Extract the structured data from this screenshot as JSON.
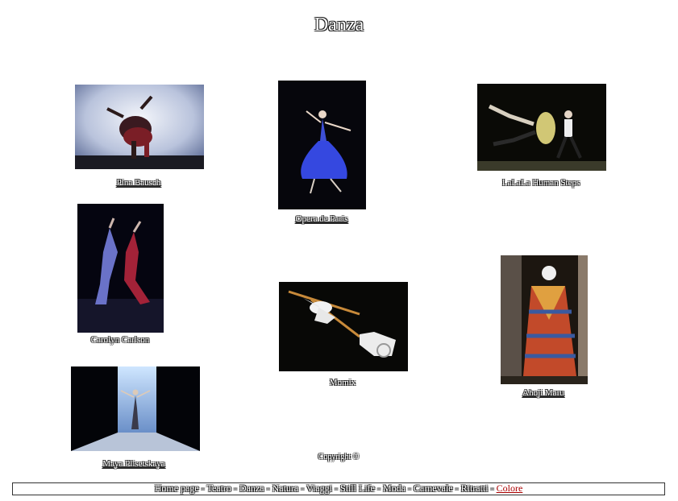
{
  "title": "Danza",
  "gallery": [
    {
      "caption": "Pina Bausch"
    },
    {
      "caption": "Opera de Paris"
    },
    {
      "caption": "LaLaLa Human Steps"
    },
    {
      "caption": "Carolyn Carlson"
    },
    {
      "caption": "Momix"
    },
    {
      "caption": "Ahoji Maru"
    },
    {
      "caption": "Maya Plisetskaya"
    }
  ],
  "copyright": "Copyright ©",
  "nav": {
    "items": [
      {
        "label": "Home page"
      },
      {
        "label": "Teatro"
      },
      {
        "label": "Danza"
      },
      {
        "label": "Natura"
      },
      {
        "label": "Viaggi"
      },
      {
        "label": "Still Life"
      },
      {
        "label": "Moda"
      },
      {
        "label": "Carnevale"
      },
      {
        "label": "Ritratti"
      },
      {
        "label": "Colore"
      }
    ],
    "separator": " - ",
    "active_color": "#aa0000"
  }
}
